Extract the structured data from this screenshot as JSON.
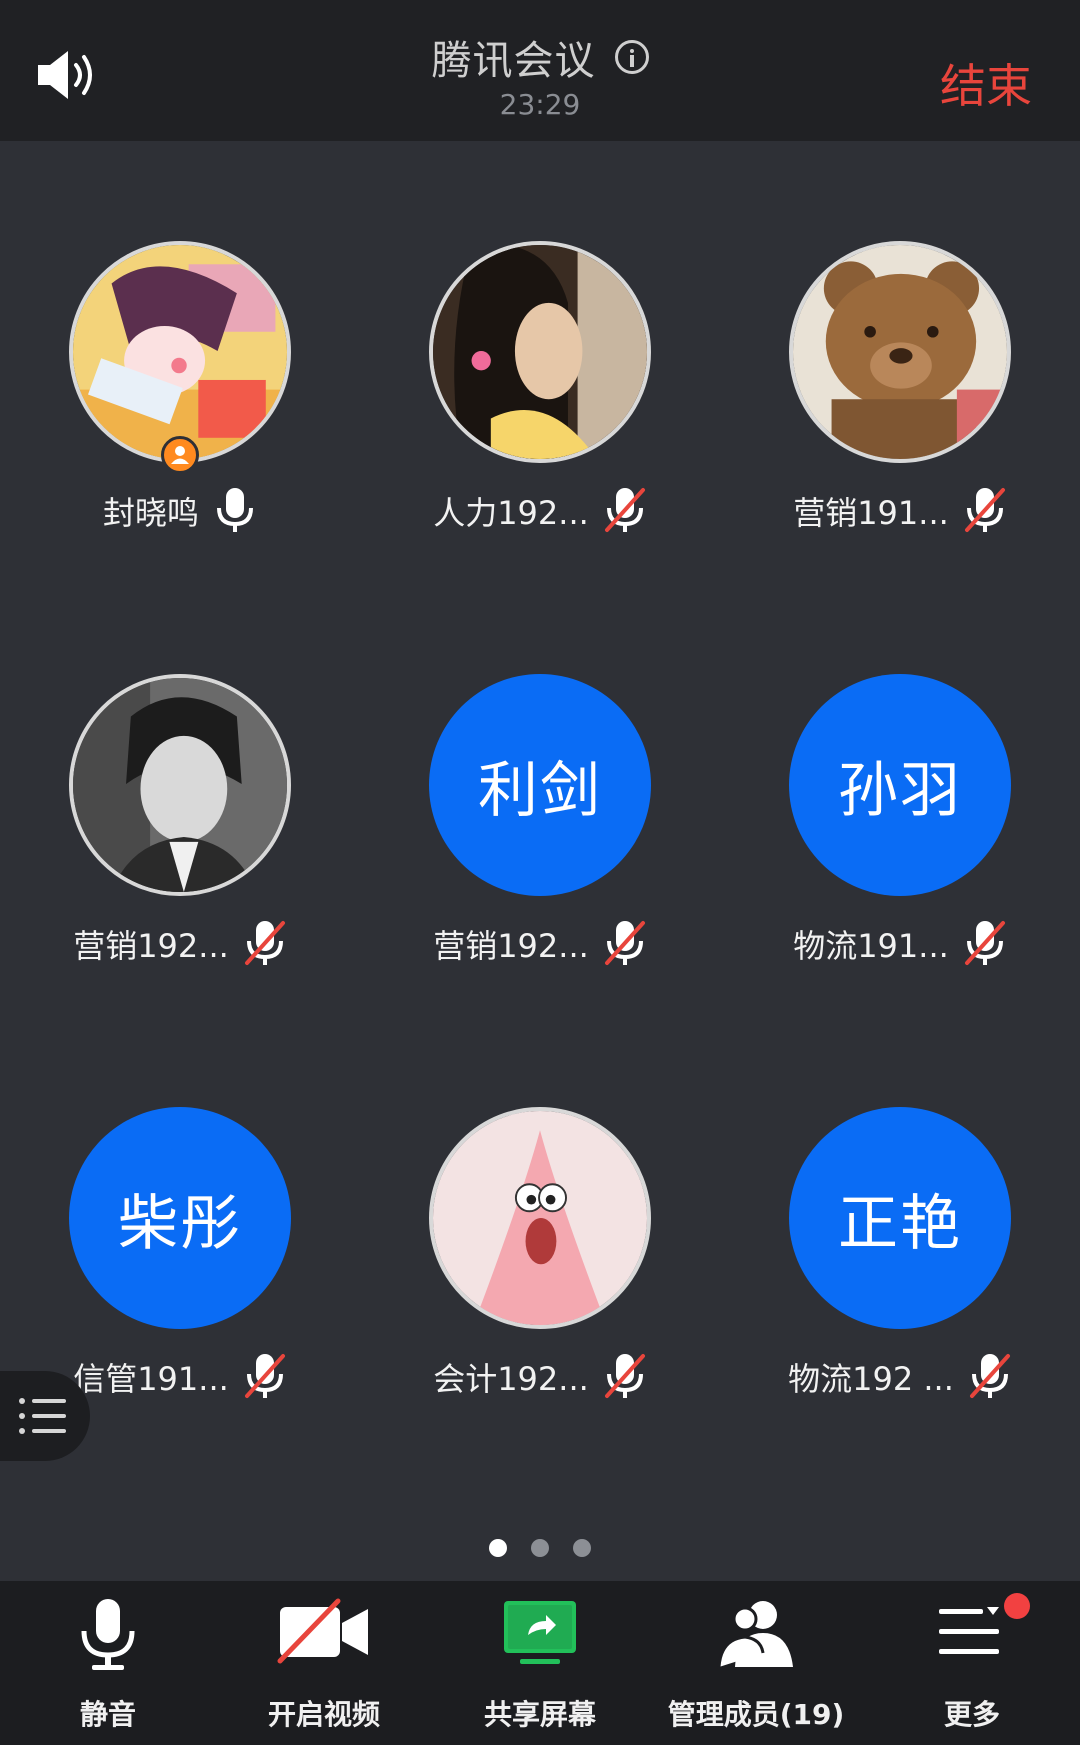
{
  "header": {
    "title": "腾讯会议",
    "time": "23:29",
    "end_label": "结束",
    "speaker_icon": "speaker-icon",
    "info_icon": "info-icon"
  },
  "participants": [
    {
      "name": "封晓鸣",
      "avatar_type": "photo",
      "avatar_desc": "cartoon-girl",
      "mic": "on",
      "is_host": true
    },
    {
      "name": "人力192...",
      "avatar_type": "photo",
      "avatar_desc": "girl-portrait",
      "mic": "muted"
    },
    {
      "name": "营销191...",
      "avatar_type": "photo",
      "avatar_desc": "teddy-bear",
      "mic": "muted"
    },
    {
      "name": "营销192...",
      "avatar_type": "photo",
      "avatar_desc": "boy-portrait",
      "mic": "muted"
    },
    {
      "name": "营销192...",
      "avatar_type": "text",
      "avatar_text": "利剑",
      "mic": "muted"
    },
    {
      "name": "物流191...",
      "avatar_type": "text",
      "avatar_text": "孙羽",
      "mic": "muted"
    },
    {
      "name": "信管191...",
      "avatar_type": "text",
      "avatar_text": "柴彤",
      "mic": "muted"
    },
    {
      "name": "会计192...",
      "avatar_type": "photo",
      "avatar_desc": "patrick-star",
      "mic": "muted"
    },
    {
      "name": "物流192 ...",
      "avatar_type": "text",
      "avatar_text": "正艳",
      "mic": "muted"
    }
  ],
  "pager": {
    "total": 3,
    "active": 1
  },
  "toolbar": {
    "mute_label": "静音",
    "video_label": "开启视频",
    "share_label": "共享屏幕",
    "members_label": "管理成员(19)",
    "more_label": "更多"
  },
  "colors": {
    "accent_blue": "#0a6cf5",
    "end_red": "#e8453c",
    "mute_slash_red": "#e8453c",
    "share_green": "#22c05a"
  }
}
